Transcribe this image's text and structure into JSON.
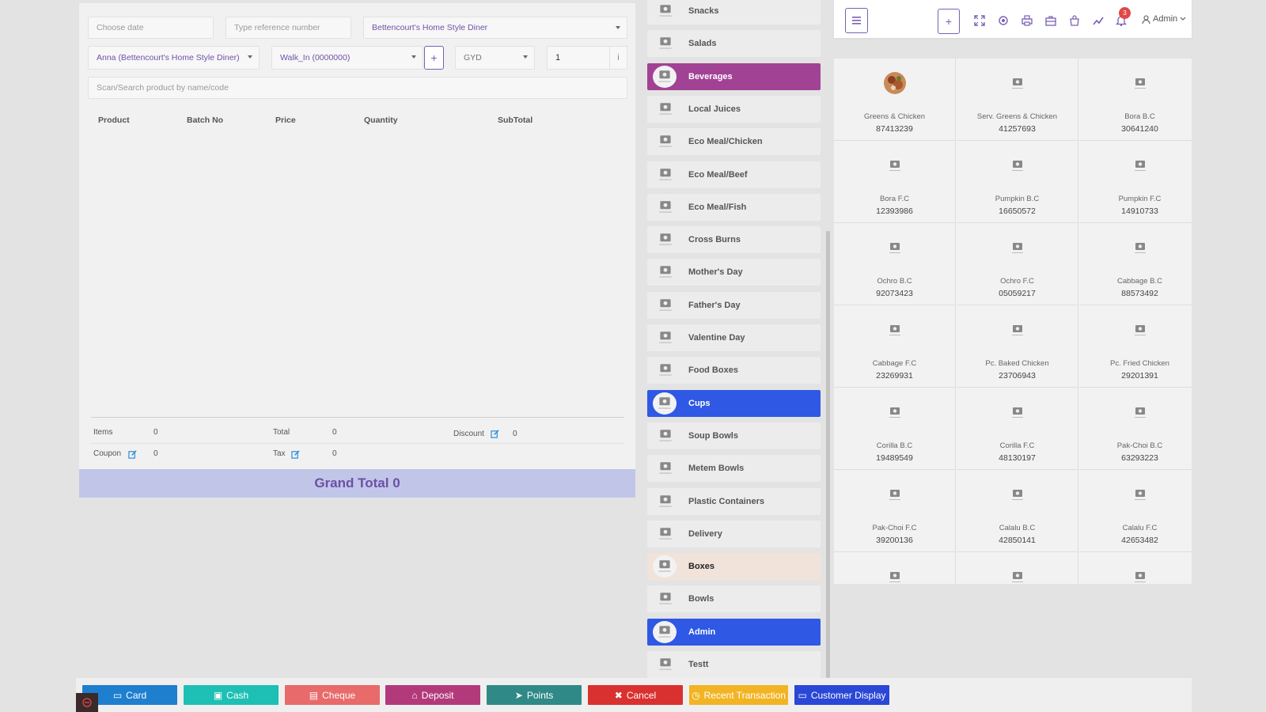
{
  "form": {
    "date_placeholder": "Choose date",
    "reference_placeholder": "Type reference number",
    "restaurant": "Bettencourt's Home Style Diner",
    "customer": "Anna (Bettencourt's Home Style Diner)",
    "order_type": "Walk_In (0000000)",
    "currency": "GYD",
    "quantity": "1",
    "info_label": "i",
    "add_label": "+",
    "search_placeholder": "Scan/Search product by name/code"
  },
  "table": {
    "columns": [
      "Product",
      "Batch No",
      "Price",
      "Quantity",
      "SubTotal"
    ]
  },
  "summary": {
    "items_label": "Items",
    "items_value": "0",
    "total_label": "Total",
    "total_value": "0",
    "discount_label": "Discount",
    "discount_value": "0",
    "coupon_label": "Coupon",
    "coupon_value": "0",
    "tax_label": "Tax",
    "tax_value": "0",
    "grand_total": "Grand Total 0"
  },
  "categories": [
    {
      "label": "Snacks",
      "style": "normal"
    },
    {
      "label": "Salads",
      "style": "normal"
    },
    {
      "label": "Beverages",
      "style": "purple"
    },
    {
      "label": "Local Juices",
      "style": "normal"
    },
    {
      "label": "Eco Meal/Chicken",
      "style": "normal"
    },
    {
      "label": "Eco Meal/Beef",
      "style": "normal"
    },
    {
      "label": "Eco Meal/Fish",
      "style": "normal"
    },
    {
      "label": "Cross Burns",
      "style": "normal"
    },
    {
      "label": "Mother's Day",
      "style": "normal"
    },
    {
      "label": "Father's Day",
      "style": "normal"
    },
    {
      "label": "Valentine Day",
      "style": "normal"
    },
    {
      "label": "Food Boxes",
      "style": "normal"
    },
    {
      "label": "Cups",
      "style": "blue"
    },
    {
      "label": "Soup Bowls",
      "style": "normal"
    },
    {
      "label": "Metem Bowls",
      "style": "normal"
    },
    {
      "label": "Plastic Containers",
      "style": "normal"
    },
    {
      "label": "Delivery",
      "style": "normal"
    },
    {
      "label": "Boxes",
      "style": "beige"
    },
    {
      "label": "Bowls",
      "style": "normal"
    },
    {
      "label": "Admin",
      "style": "blue"
    },
    {
      "label": "Testt",
      "style": "normal"
    }
  ],
  "topbar": {
    "menu_icon": "hamburger-icon",
    "add_icon": "plus-icon",
    "add_label": "+",
    "notification_count": "3",
    "admin_label": "Admin"
  },
  "products": [
    {
      "name": "Greens & Chicken",
      "code": "87413239",
      "image": "food"
    },
    {
      "name": "Serv. Greens & Chicken",
      "code": "41257693",
      "image": "placeholder"
    },
    {
      "name": "Bora B.C",
      "code": "30641240",
      "image": "placeholder"
    },
    {
      "name": "Bora F.C",
      "code": "12393986",
      "image": "placeholder"
    },
    {
      "name": "Pumpkin B.C",
      "code": "16650572",
      "image": "placeholder"
    },
    {
      "name": "Pumpkin F.C",
      "code": "14910733",
      "image": "placeholder"
    },
    {
      "name": "Ochro B.C",
      "code": "92073423",
      "image": "placeholder"
    },
    {
      "name": "Ochro F.C",
      "code": "05059217",
      "image": "placeholder"
    },
    {
      "name": "Cabbage B.C",
      "code": "88573492",
      "image": "placeholder"
    },
    {
      "name": "Cabbage F.C",
      "code": "23269931",
      "image": "placeholder"
    },
    {
      "name": "Pc. Baked Chicken",
      "code": "23706943",
      "image": "placeholder"
    },
    {
      "name": "Pc. Fried Chicken",
      "code": "29201391",
      "image": "placeholder"
    },
    {
      "name": "Corilla B.C",
      "code": "19489549",
      "image": "placeholder"
    },
    {
      "name": "Corilla F.C",
      "code": "48130197",
      "image": "placeholder"
    },
    {
      "name": "Pak-Choi B.C",
      "code": "63293223",
      "image": "placeholder"
    },
    {
      "name": "Pak-Choi F.C",
      "code": "39200136",
      "image": "placeholder"
    },
    {
      "name": "Calalu B.C",
      "code": "42850141",
      "image": "placeholder"
    },
    {
      "name": "Calalu F.C",
      "code": "42653482",
      "image": "placeholder"
    },
    {
      "name": "",
      "code": "",
      "image": "placeholder"
    },
    {
      "name": "",
      "code": "",
      "image": "placeholder"
    },
    {
      "name": "",
      "code": "",
      "image": "placeholder"
    }
  ],
  "payments": [
    {
      "label": "Card",
      "icon": "credit-card-icon",
      "color": "#1f7fcf"
    },
    {
      "label": "Cash",
      "icon": "cash-icon",
      "color": "#1ebfb4"
    },
    {
      "label": "Cheque",
      "icon": "cheque-icon",
      "color": "#e86a6a"
    },
    {
      "label": "Deposit",
      "icon": "bank-icon",
      "color": "#b23a7b"
    },
    {
      "label": "Points",
      "icon": "rocket-icon",
      "color": "#2f8a87"
    },
    {
      "label": "Cancel",
      "icon": "close-icon",
      "color": "#d9312f"
    },
    {
      "label": "Recent Transaction",
      "icon": "clock-icon",
      "color": "#f2b424"
    },
    {
      "label": "Customer Display",
      "icon": "monitor-icon",
      "color": "#2a47d6"
    }
  ]
}
